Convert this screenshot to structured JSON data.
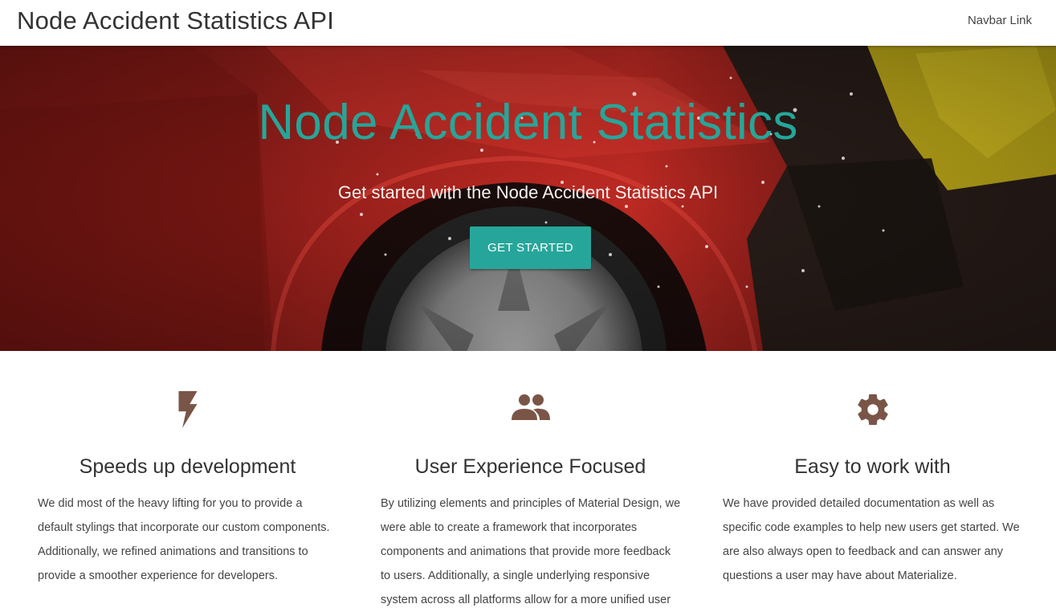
{
  "navbar": {
    "brand": "Node Accident Statistics API",
    "link_label": "Navbar Link"
  },
  "hero": {
    "title": "Node Accident Statistics",
    "subtitle": "Get started with the Node Accident Statistics API",
    "button_label": "GET STARTED"
  },
  "features": [
    {
      "icon": "flash-icon",
      "title": "Speeds up development",
      "text": "We did most of the heavy lifting for you to provide a default stylings that incorporate our custom components. Additionally, we refined animations and transitions to provide a smoother experience for developers."
    },
    {
      "icon": "group-icon",
      "title": "User Experience Focused",
      "text": "By utilizing elements and principles of Material Design, we were able to create a framework that incorporates components and animations that provide more feedback to users. Additionally, a single underlying responsive system across all platforms allow for a more unified user"
    },
    {
      "icon": "settings-icon",
      "title": "Easy to work with",
      "text": "We have provided detailed documentation as well as specific code examples to help new users get started. We are also always open to feedback and can answer any questions a user may have about Materialize."
    }
  ],
  "colors": {
    "accent": "#26a69a",
    "icon_brown": "#795548"
  }
}
